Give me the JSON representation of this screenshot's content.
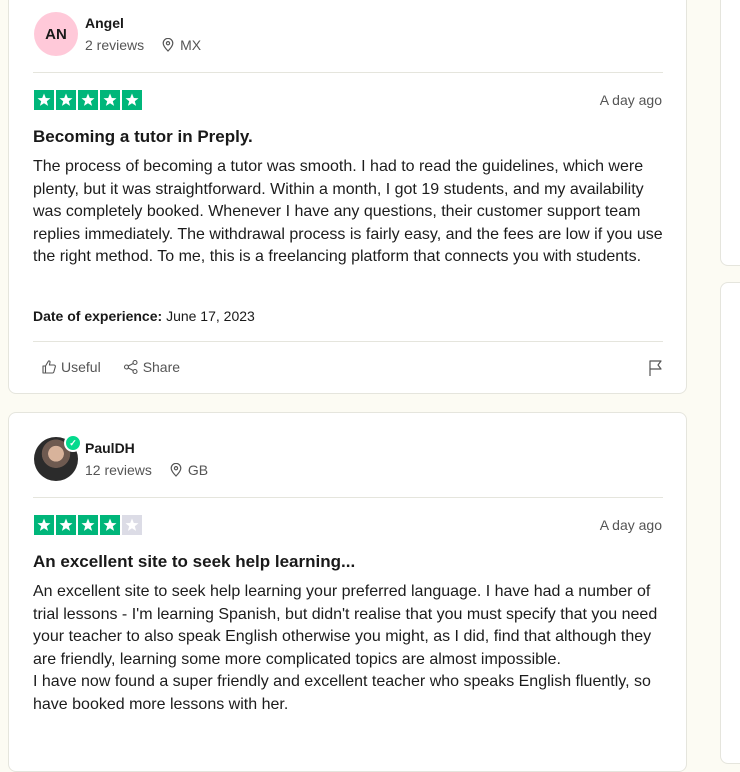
{
  "reviews": [
    {
      "avatar_initials": "AN",
      "avatar_color": "#ffc9d9",
      "name": "Angel",
      "review_count": "2 reviews",
      "location": "MX",
      "rating": 5,
      "date": "A day ago",
      "title": "Becoming a tutor in Preply.",
      "body": [
        "The process of becoming a tutor was smooth. I had to read the guidelines, which were plenty, but it was straightforward. Within a month, I got 19 students, and my availability was completely booked. Whenever I have any questions, their customer support team replies immediately. The withdrawal process is fairly easy, and the fees are low if you use the right method. To me, this is a freelancing platform that connects you with students."
      ],
      "experience_label": "Date of experience:",
      "experience_date": "June 17, 2023",
      "useful_label": "Useful",
      "share_label": "Share"
    },
    {
      "name": "PaulDH",
      "verified": true,
      "review_count": "12 reviews",
      "location": "GB",
      "rating": 4,
      "date": "A day ago",
      "title": "An excellent site to seek help learning...",
      "body": [
        "An excellent site to seek help learning your preferred language. I have had a number of trial lessons - I'm learning Spanish, but didn't realise that you must specify that you need your teacher to also speak English otherwise you might, as I did, find that although they are friendly, learning some more complicated topics are almost impossible.",
        "I have now found a super friendly and excellent teacher who speaks English fluently, so have booked more lessons with her."
      ]
    }
  ],
  "colors": {
    "star_on": "#00b67a",
    "star_off": "#dcdce6",
    "page_bg": "#fcfbf3",
    "verified": "#04da8d"
  }
}
